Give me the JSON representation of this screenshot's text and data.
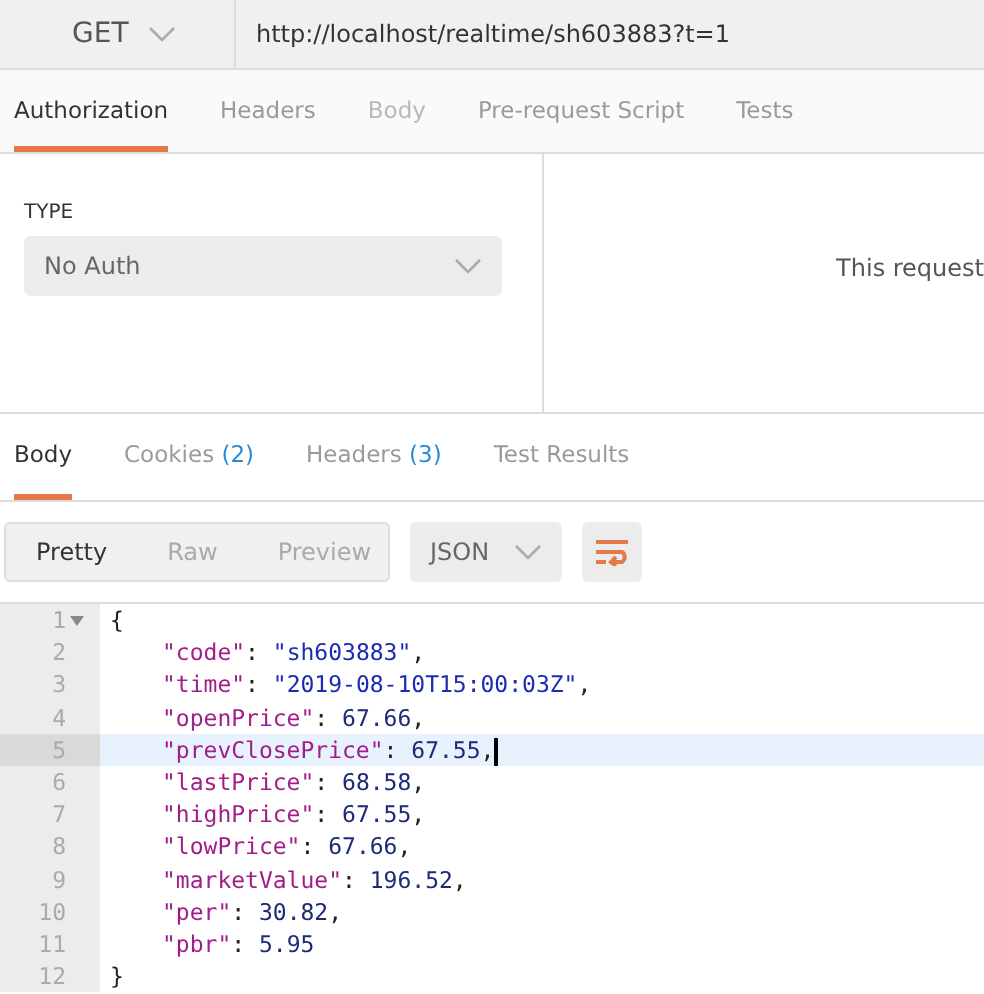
{
  "request": {
    "method": "GET",
    "url": "http://localhost/realtime/sh603883?t=1"
  },
  "request_tabs": [
    {
      "label": "Authorization",
      "selected": true,
      "disabled": false
    },
    {
      "label": "Headers",
      "selected": false,
      "disabled": false
    },
    {
      "label": "Body",
      "selected": false,
      "disabled": true
    },
    {
      "label": "Pre-request Script",
      "selected": false,
      "disabled": false
    },
    {
      "label": "Tests",
      "selected": false,
      "disabled": false
    }
  ],
  "auth": {
    "type_label": "TYPE",
    "type_value": "No Auth",
    "note": "This request"
  },
  "response_tabs": [
    {
      "label": "Body",
      "selected": true
    },
    {
      "label": "Cookies",
      "count": "(2)",
      "selected": false
    },
    {
      "label": "Headers",
      "count": "(3)",
      "selected": false
    },
    {
      "label": "Test Results",
      "selected": false
    }
  ],
  "view_modes": [
    {
      "label": "Pretty",
      "selected": true
    },
    {
      "label": "Raw",
      "selected": false
    },
    {
      "label": "Preview",
      "selected": false
    }
  ],
  "format": "JSON",
  "code_lines": [
    {
      "number": "1",
      "fold": true,
      "current": false,
      "indented": false,
      "tokens": [
        {
          "kind": "punct",
          "text": "{"
        }
      ]
    },
    {
      "number": "2",
      "fold": false,
      "current": false,
      "indented": true,
      "tokens": [
        {
          "kind": "key",
          "text": "\"code\""
        },
        {
          "kind": "punct",
          "text": ": "
        },
        {
          "kind": "string",
          "text": "\"sh603883\""
        },
        {
          "kind": "punct",
          "text": ","
        }
      ]
    },
    {
      "number": "3",
      "fold": false,
      "current": false,
      "indented": true,
      "tokens": [
        {
          "kind": "key",
          "text": "\"time\""
        },
        {
          "kind": "punct",
          "text": ": "
        },
        {
          "kind": "string",
          "text": "\"2019-08-10T15:00:03Z\""
        },
        {
          "kind": "punct",
          "text": ","
        }
      ]
    },
    {
      "number": "4",
      "fold": false,
      "current": false,
      "indented": true,
      "tokens": [
        {
          "kind": "key",
          "text": "\"openPrice\""
        },
        {
          "kind": "punct",
          "text": ": "
        },
        {
          "kind": "number",
          "text": "67.66"
        },
        {
          "kind": "punct",
          "text": ","
        }
      ]
    },
    {
      "number": "5",
      "fold": false,
      "current": true,
      "indented": true,
      "tokens": [
        {
          "kind": "key",
          "text": "\"prevClosePrice\""
        },
        {
          "kind": "punct",
          "text": ": "
        },
        {
          "kind": "number",
          "text": "67.55"
        },
        {
          "kind": "punct",
          "text": ","
        }
      ]
    },
    {
      "number": "6",
      "fold": false,
      "current": false,
      "indented": true,
      "tokens": [
        {
          "kind": "key",
          "text": "\"lastPrice\""
        },
        {
          "kind": "punct",
          "text": ": "
        },
        {
          "kind": "number",
          "text": "68.58"
        },
        {
          "kind": "punct",
          "text": ","
        }
      ]
    },
    {
      "number": "7",
      "fold": false,
      "current": false,
      "indented": true,
      "tokens": [
        {
          "kind": "key",
          "text": "\"highPrice\""
        },
        {
          "kind": "punct",
          "text": ": "
        },
        {
          "kind": "number",
          "text": "67.55"
        },
        {
          "kind": "punct",
          "text": ","
        }
      ]
    },
    {
      "number": "8",
      "fold": false,
      "current": false,
      "indented": true,
      "tokens": [
        {
          "kind": "key",
          "text": "\"lowPrice\""
        },
        {
          "kind": "punct",
          "text": ": "
        },
        {
          "kind": "number",
          "text": "67.66"
        },
        {
          "kind": "punct",
          "text": ","
        }
      ]
    },
    {
      "number": "9",
      "fold": false,
      "current": false,
      "indented": true,
      "tokens": [
        {
          "kind": "key",
          "text": "\"marketValue\""
        },
        {
          "kind": "punct",
          "text": ": "
        },
        {
          "kind": "number",
          "text": "196.52"
        },
        {
          "kind": "punct",
          "text": ","
        }
      ]
    },
    {
      "number": "10",
      "fold": false,
      "current": false,
      "indented": true,
      "tokens": [
        {
          "kind": "key",
          "text": "\"per\""
        },
        {
          "kind": "punct",
          "text": ": "
        },
        {
          "kind": "number",
          "text": "30.82"
        },
        {
          "kind": "punct",
          "text": ","
        }
      ]
    },
    {
      "number": "11",
      "fold": false,
      "current": false,
      "indented": true,
      "tokens": [
        {
          "kind": "key",
          "text": "\"pbr\""
        },
        {
          "kind": "punct",
          "text": ": "
        },
        {
          "kind": "number",
          "text": "5.95"
        }
      ]
    },
    {
      "number": "12",
      "fold": false,
      "current": false,
      "indented": false,
      "tokens": [
        {
          "kind": "punct",
          "text": "}"
        }
      ]
    }
  ]
}
